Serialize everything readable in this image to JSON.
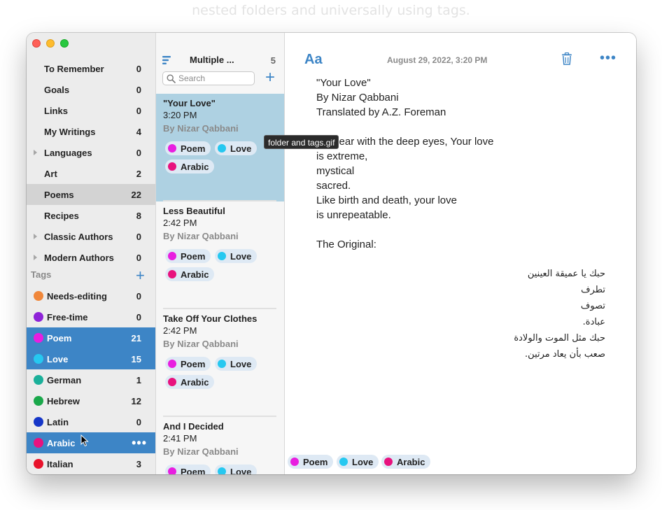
{
  "caption": "nested folders and universally using tags.",
  "sidebar": {
    "folders": [
      {
        "label": "To Remember",
        "count": "0",
        "disclosure": false
      },
      {
        "label": "Goals",
        "count": "0",
        "disclosure": false
      },
      {
        "label": "Links",
        "count": "0",
        "disclosure": false
      },
      {
        "label": "My Writings",
        "count": "4",
        "disclosure": false
      },
      {
        "label": "Languages",
        "count": "0",
        "disclosure": true
      },
      {
        "label": "Art",
        "count": "2",
        "disclosure": false
      },
      {
        "label": "Poems",
        "count": "22",
        "disclosure": false
      },
      {
        "label": "Recipes",
        "count": "8",
        "disclosure": false
      },
      {
        "label": "Classic Authors",
        "count": "0",
        "disclosure": true
      },
      {
        "label": "Modern Authors",
        "count": "0",
        "disclosure": true
      }
    ],
    "tags_header": "Tags",
    "tags": [
      {
        "label": "Needs-editing",
        "count": "0",
        "color": "#f0873a"
      },
      {
        "label": "Free-time",
        "count": "0",
        "color": "#8e23d8"
      },
      {
        "label": "Poem",
        "count": "21",
        "color": "#e81ee0"
      },
      {
        "label": "Love",
        "count": "15",
        "color": "#26c8f0"
      },
      {
        "label": "German",
        "count": "1",
        "color": "#1bb09a"
      },
      {
        "label": "Hebrew",
        "count": "12",
        "color": "#1aa84b"
      },
      {
        "label": "Latin",
        "count": "0",
        "color": "#1536c8"
      },
      {
        "label": "Arabic",
        "count": "",
        "color": "#e8127e"
      },
      {
        "label": "Italian",
        "count": "3",
        "color": "#e8122b"
      }
    ]
  },
  "notelist": {
    "title": "Multiple ...",
    "count": "5",
    "search_placeholder": "Search",
    "notes": [
      {
        "title": "\"Your Love\"",
        "time": "3:20 PM",
        "snippet": "By Nizar Qabbani",
        "tags": [
          "Poem",
          "Love",
          "Arabic"
        ]
      },
      {
        "title": "Less Beautiful",
        "time": "2:42 PM",
        "snippet": "By Nizar Qabbani",
        "tags": [
          "Poem",
          "Love",
          "Arabic"
        ]
      },
      {
        "title": "Take Off Your Clothes",
        "time": "2:42 PM",
        "snippet": "By Nizar Qabbani",
        "tags": [
          "Poem",
          "Love",
          "Arabic"
        ]
      },
      {
        "title": "And I Decided",
        "time": "2:41 PM",
        "snippet": "By Nizar Qabbani",
        "tags": [
          "Poem",
          "Love"
        ]
      }
    ]
  },
  "tooltip": "folder and tags.gif",
  "editor": {
    "font_button": "Aa",
    "date": "August 29, 2022, 3:20 PM",
    "body_lines": [
      "\"Your Love\"",
      "By Nizar Qabbani",
      "Translated by A.Z. Foreman",
      "",
      "My dear with the deep eyes, Your love",
      "is extreme,",
      "mystical",
      "sacred.",
      "Like birth and death, your love",
      "is unrepeatable.",
      "",
      "The Original:"
    ],
    "arabic_lines": [
      "حبك يا عميقة العينين",
      "تطرف",
      "تصوف",
      "عبادة.",
      "حبك مثل الموت والولادة",
      "صعب بأن يعاد مرتين."
    ],
    "tags": [
      "Poem",
      "Love",
      "Arabic"
    ]
  },
  "colors": {
    "accent": "#3d85c6",
    "selected_note": "#aed1e2",
    "chip": "#dee9f4",
    "Poem": "#e81ee0",
    "Love": "#26c8f0",
    "Arabic": "#e8127e"
  }
}
